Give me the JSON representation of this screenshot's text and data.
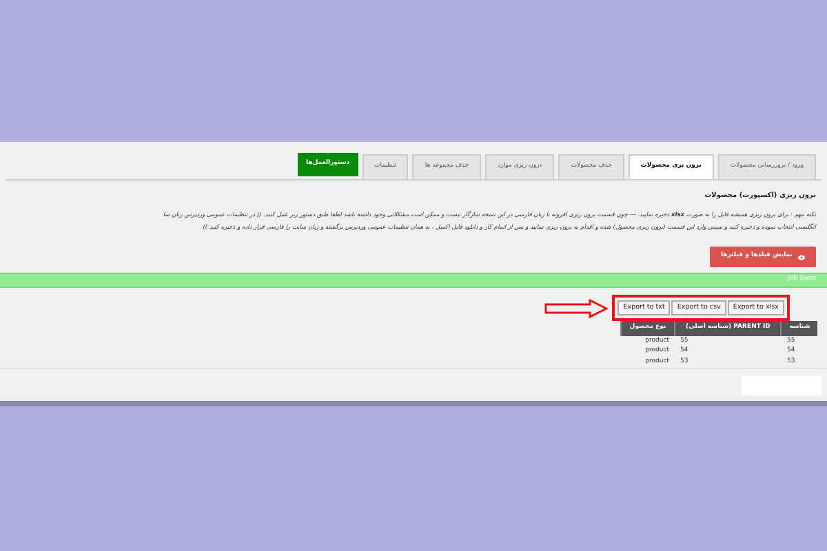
{
  "tabs": [
    {
      "label": "ورود / بروزرسانی محصولات",
      "selected": false,
      "kind": "tab"
    },
    {
      "label": "برون بری محصولات",
      "selected": true,
      "kind": "tab"
    },
    {
      "label": "حذف محصولات",
      "selected": false,
      "kind": "tab"
    },
    {
      "label": "درون ریزی موارد",
      "selected": false,
      "kind": "tab"
    },
    {
      "label": "حذف مجموعه ها",
      "selected": false,
      "kind": "tab"
    },
    {
      "label": "تنظیمات",
      "selected": false,
      "kind": "tab"
    },
    {
      "label": "دستورالعمل‌ها",
      "selected": false,
      "kind": "primary"
    }
  ],
  "heading": "برون ریزی (اکسپورت) محصولات",
  "notice": "نکته مهم : برای برون ریزی همیشه فایل را به صورت **xlsx** ذخیره نمایید. --- چون قسمت برون ریزی افزونه با زبان فارسی در این نسخه سازگار نیست و ممکن است مشکلاتی وجود داشته باشد لطفا طبق دستور زیر عمل کنید. (( در تنظیمات عمومی وردپرس زبان سا",
  "notice_line_2": "انگلیسی انتخاب نموده و ذخیره کنید و سپس وارد این قسمت (برون ریزی محصول) شده و اقدام به برون ریزی نمایید و پس از اتمام کار و دانلود فایل اکسل ، به همان تنظیمات عمومی وردپرس برگشته و زبان سایت را فارسی قرار داده و ذخیره کنید ))",
  "fields_button": "نمایش فیلدها و فیلترها",
  "status": "Job Done",
  "export_buttons": [
    "Export to xlsx",
    "Export to csv",
    "Export to txt"
  ],
  "table": {
    "columns": [
      "شناسه",
      "PARENT ID (شناسه اصلی)",
      "نوع محصول"
    ],
    "rows": [
      [
        "55",
        "55",
        "product"
      ],
      [
        "54",
        "54",
        "product"
      ],
      [
        "53",
        "53",
        "product"
      ]
    ]
  }
}
